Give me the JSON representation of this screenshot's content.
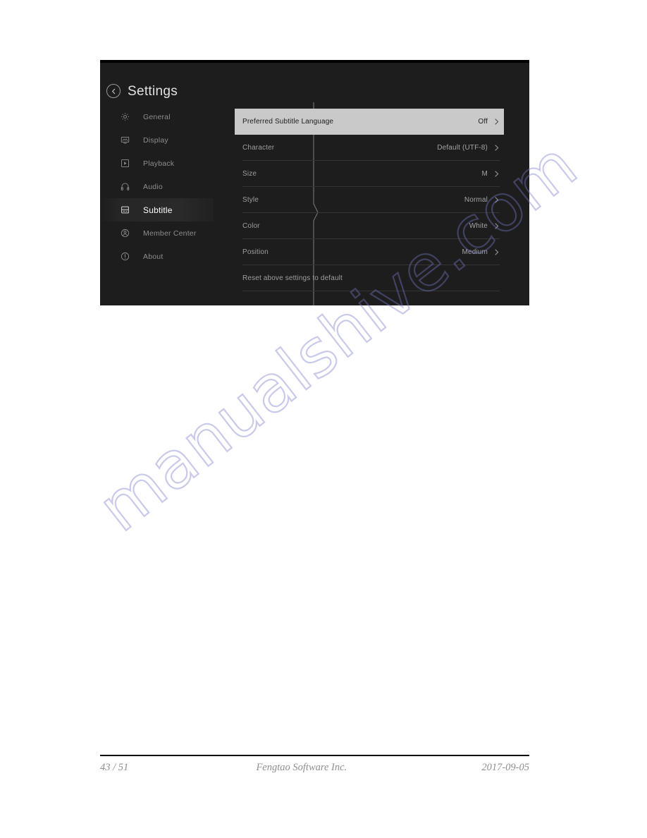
{
  "document": {
    "footer": {
      "page_number": "43 / 51",
      "company": "Fengtao Software Inc.",
      "date": "2017-09-05"
    },
    "watermark": "manualshive.com"
  },
  "screenshot": {
    "header": {
      "back_icon": "back-chevron-circle-icon",
      "title": "Settings"
    },
    "sidebar": {
      "items": [
        {
          "label": "General",
          "icon": "gear-icon",
          "active": false
        },
        {
          "label": "Display",
          "icon": "monitor-icon",
          "active": false
        },
        {
          "label": "Playback",
          "icon": "play-box-icon",
          "active": false
        },
        {
          "label": "Audio",
          "icon": "headphones-icon",
          "active": false
        },
        {
          "label": "Subtitle",
          "icon": "subtitle-box-icon",
          "active": true
        },
        {
          "label": "Member Center",
          "icon": "person-circle-icon",
          "active": false
        },
        {
          "label": "About",
          "icon": "info-circle-icon",
          "active": false
        }
      ]
    },
    "settings_list": {
      "rows": [
        {
          "label": "Preferred Subtitle Language",
          "value": "Off",
          "chevron": true,
          "selected": true
        },
        {
          "label": "Character",
          "value": "Default (UTF-8)",
          "chevron": true,
          "selected": false
        },
        {
          "label": "Size",
          "value": "M",
          "chevron": true,
          "selected": false
        },
        {
          "label": "Style",
          "value": "Normal",
          "chevron": true,
          "selected": false
        },
        {
          "label": "Color",
          "value": "White",
          "chevron": true,
          "selected": false
        },
        {
          "label": "Position",
          "value": "Medium",
          "chevron": true,
          "selected": false
        },
        {
          "label": "Reset above settings to default",
          "value": "",
          "chevron": false,
          "selected": false
        }
      ]
    },
    "colors": {
      "panel_background": "#1d1d1d",
      "selected_row_background": "#c9c9c9",
      "selected_row_text": "#20201f",
      "label_text": "#9e9e9e",
      "active_sidebar_text": "#ffffff",
      "divider": "#343434",
      "watermark": "#7676c8"
    }
  }
}
